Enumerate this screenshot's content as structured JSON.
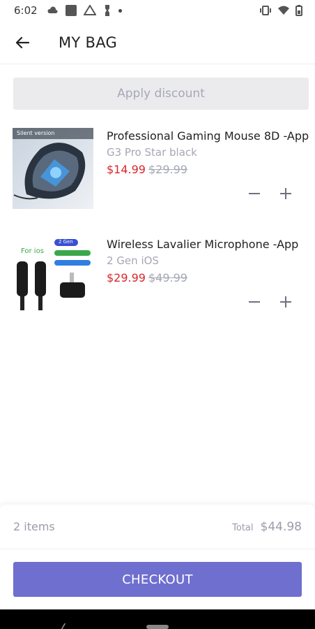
{
  "status_bar": {
    "time": "6:02",
    "left_icons": [
      "cloud-icon",
      "square-icon",
      "drive-icon",
      "usb-icon",
      "dot-icon"
    ],
    "right_icons": [
      "vibrate-icon",
      "wifi-icon",
      "battery-icon"
    ]
  },
  "header": {
    "title": "MY BAG"
  },
  "discount": {
    "label": "Apply discount"
  },
  "items": [
    {
      "name": "Professional Gaming Mouse 8D -App",
      "variant": "G3 Pro Star black",
      "price": "$14.99",
      "old_price": "$29.99",
      "image_caption": "Silent version"
    },
    {
      "name": "Wireless Lavalier Microphone -App",
      "variant": "2 Gen iOS",
      "price": "$29.99",
      "old_price": "$49.99",
      "image_caption": "For ios",
      "image_badge": "2 Gen"
    }
  ],
  "summary": {
    "count": "2 items",
    "total_label": "Total",
    "total_value": "$44.98"
  },
  "checkout": {
    "label": "CHECKOUT"
  },
  "colors": {
    "accent": "#6f6fcf",
    "price_red": "#d8272d",
    "muted": "#a5a7b5"
  }
}
